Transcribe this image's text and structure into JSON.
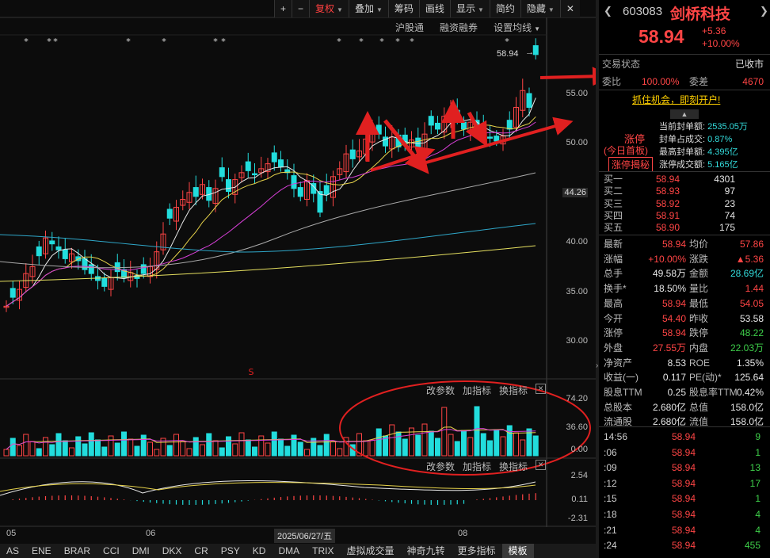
{
  "toolbar": {
    "plus": "+",
    "minus": "−",
    "fuquan": "复权",
    "diejia": "叠加",
    "chouma": "筹码",
    "huaxian": "画线",
    "xianshi": "显示",
    "jianyue": "简约",
    "yincang": "隐藏",
    "close": "✕"
  },
  "chart_links": {
    "hugutong": "沪股通",
    "rongzi": "融资融券",
    "set_ma": "设置均线"
  },
  "price_axis": [
    "55.00",
    "50.00",
    "44.26",
    "40.00",
    "35.00",
    "30.00"
  ],
  "price_tag": "58.94",
  "volume_panel": {
    "change_param": "改参数",
    "add_indicator": "加指标",
    "switch_indicator": "换指标",
    "axis": [
      "74.20",
      "36.60",
      "0.00"
    ]
  },
  "macd_panel": {
    "change_param": "改参数",
    "add_indicator": "加指标",
    "switch_indicator": "换指标",
    "axis": [
      "2.54",
      "0.11",
      "-2.31"
    ]
  },
  "xaxis": {
    "labels": [
      "05",
      "06",
      "08"
    ],
    "date": "2025/06/27/五"
  },
  "bottom_tabs": [
    "AS",
    "ENE",
    "BRAR",
    "CCI",
    "DMI",
    "DKX",
    "CR",
    "PSY",
    "KD",
    "DMA",
    "TRIX",
    "虚拟成交量",
    "神奇九转",
    "更多指标",
    "模板"
  ],
  "stock": {
    "code": "603083",
    "name": "剑桥科技",
    "price": "58.94",
    "change": "+5.36",
    "change_pct": "+10.00%"
  },
  "status": {
    "label": "交易状态",
    "value": "已收市"
  },
  "weibi": {
    "label1": "委比",
    "value1": "100.00%",
    "label2": "委差",
    "value2": "4670"
  },
  "banner": "抓住机会，即刻开户!",
  "limit_up": {
    "tag1": "涨停",
    "tag2": "(今日首板)",
    "tag3": "涨停揭秘",
    "rows": [
      {
        "label": "当前封单额:",
        "value": "2535.05万"
      },
      {
        "label": "封单占成交:",
        "value": "0.87%"
      },
      {
        "label": "最高封单额:",
        "value": "4.395亿"
      },
      {
        "label": "涨停成交额:",
        "value": "5.165亿"
      }
    ]
  },
  "bids": [
    {
      "label": "买一",
      "price": "58.94",
      "vol": "4301"
    },
    {
      "label": "买二",
      "price": "58.93",
      "vol": "97"
    },
    {
      "label": "买三",
      "price": "58.92",
      "vol": "23"
    },
    {
      "label": "买四",
      "price": "58.91",
      "vol": "74"
    },
    {
      "label": "买五",
      "price": "58.90",
      "vol": "175"
    }
  ],
  "stats": [
    {
      "l1": "最新",
      "v1": "58.94",
      "c1": "red",
      "l2": "均价",
      "v2": "57.86",
      "c2": "red"
    },
    {
      "l1": "涨幅",
      "v1": "+10.00%",
      "c1": "red",
      "l2": "涨跌",
      "v2": "▲5.36",
      "c2": "red"
    },
    {
      "l1": "总手",
      "v1": "49.58万",
      "c1": "white",
      "l2": "金额",
      "v2": "28.69亿",
      "c2": "cyan"
    },
    {
      "l1": "换手*",
      "v1": "18.50%",
      "c1": "white",
      "l2": "量比",
      "v2": "1.44",
      "c2": "red"
    },
    {
      "l1": "最高",
      "v1": "58.94",
      "c1": "red",
      "l2": "最低",
      "v2": "54.05",
      "c2": "red"
    },
    {
      "l1": "今开",
      "v1": "54.40",
      "c1": "red",
      "l2": "昨收",
      "v2": "53.58",
      "c2": "white"
    },
    {
      "l1": "涨停",
      "v1": "58.94",
      "c1": "red",
      "l2": "跌停",
      "v2": "48.22",
      "c2": "green"
    },
    {
      "l1": "外盘",
      "v1": "27.55万",
      "c1": "red",
      "l2": "内盘",
      "v2": "22.03万",
      "c2": "green"
    },
    {
      "l1": "净资产",
      "v1": "8.53",
      "c1": "white",
      "l2": "ROE",
      "v2": "1.35%",
      "c2": "white"
    },
    {
      "l1": "收益(一)",
      "v1": "0.117",
      "c1": "white",
      "l2": "PE(动)*",
      "v2": "125.64",
      "c2": "white"
    },
    {
      "l1": "股息TTM",
      "v1": "0.25",
      "c1": "white",
      "l2": "股息率TTM",
      "v2": "0.42%",
      "c2": "white"
    },
    {
      "l1": "总股本",
      "v1": "2.680亿",
      "c1": "white",
      "l2": "总值",
      "v2": "158.0亿",
      "c2": "white"
    },
    {
      "l1": "流通股",
      "v1": "2.680亿",
      "c1": "white",
      "l2": "流值",
      "v2": "158.0亿",
      "c2": "white"
    }
  ],
  "ticks": [
    {
      "time": "14:56",
      "price": "58.94",
      "vol": "9",
      "vc": "green"
    },
    {
      "time": ":06",
      "price": "58.94",
      "vol": "1",
      "vc": "green"
    },
    {
      "time": ":09",
      "price": "58.94",
      "vol": "13",
      "vc": "green"
    },
    {
      "time": ":12",
      "price": "58.94",
      "vol": "17",
      "vc": "green"
    },
    {
      "time": ":15",
      "price": "58.94",
      "vol": "1",
      "vc": "green"
    },
    {
      "time": ":18",
      "price": "58.94",
      "vol": "4",
      "vc": "green"
    },
    {
      "time": ":21",
      "price": "58.94",
      "vol": "4",
      "vc": "green"
    },
    {
      "time": ":24",
      "price": "58.94",
      "vol": "455",
      "vc": "green"
    }
  ],
  "colors": {
    "up": "#ff4545",
    "down": "#22dddd",
    "ma5": "#e8e8e8",
    "ma10": "#e6d24a",
    "ma20": "#d63fd6",
    "ma60": "#aaaaaa",
    "ma120": "#2fa7c9",
    "ma250": "#e6e060",
    "annotation": "#e02020"
  }
}
